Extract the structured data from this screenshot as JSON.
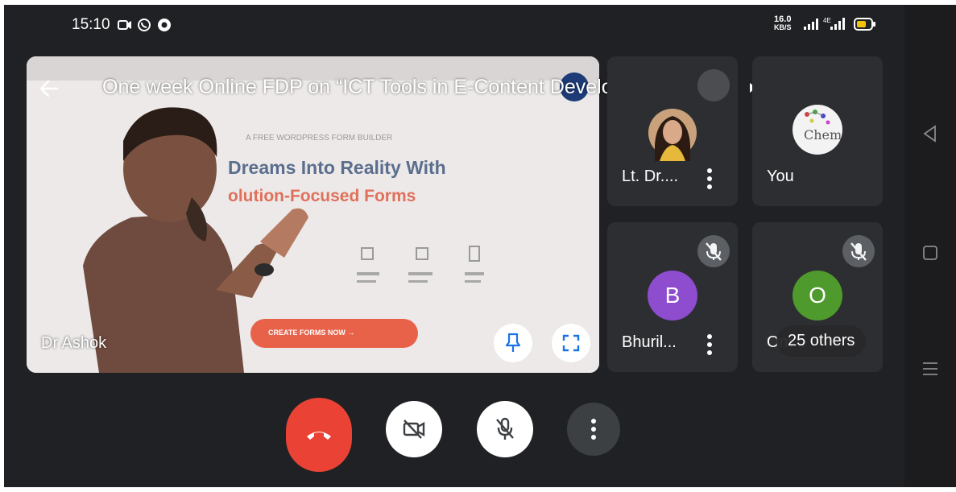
{
  "status_bar": {
    "time": "15:10",
    "speed_value": "16.0",
    "speed_unit": "KB/S"
  },
  "meeting": {
    "title": "One week Online FDP  on “ICT Tools in E-Content Development”..."
  },
  "main_tile": {
    "speaker_name": "Dr Ashok",
    "slide": {
      "small_heading": "A FREE WORDPRESS FORM BUILDER",
      "headline_line1": "Dreams Into Reality With",
      "headline_line2": "olution-Focused Forms",
      "cta": "CREATE FORMS NOW →"
    }
  },
  "participants": [
    {
      "name": "Lt. Dr....",
      "type": "photo"
    },
    {
      "name": "You",
      "type": "photo",
      "image_text": "Chem"
    },
    {
      "name": "Bhuril...",
      "initial": "B",
      "color": "#8e4ccf",
      "muted": true
    },
    {
      "name": "Om...",
      "initial": "O",
      "color": "#4f9a2d",
      "muted": true,
      "others_label": "25 others"
    }
  ],
  "controls": {
    "end_call_color": "#ea4335"
  }
}
